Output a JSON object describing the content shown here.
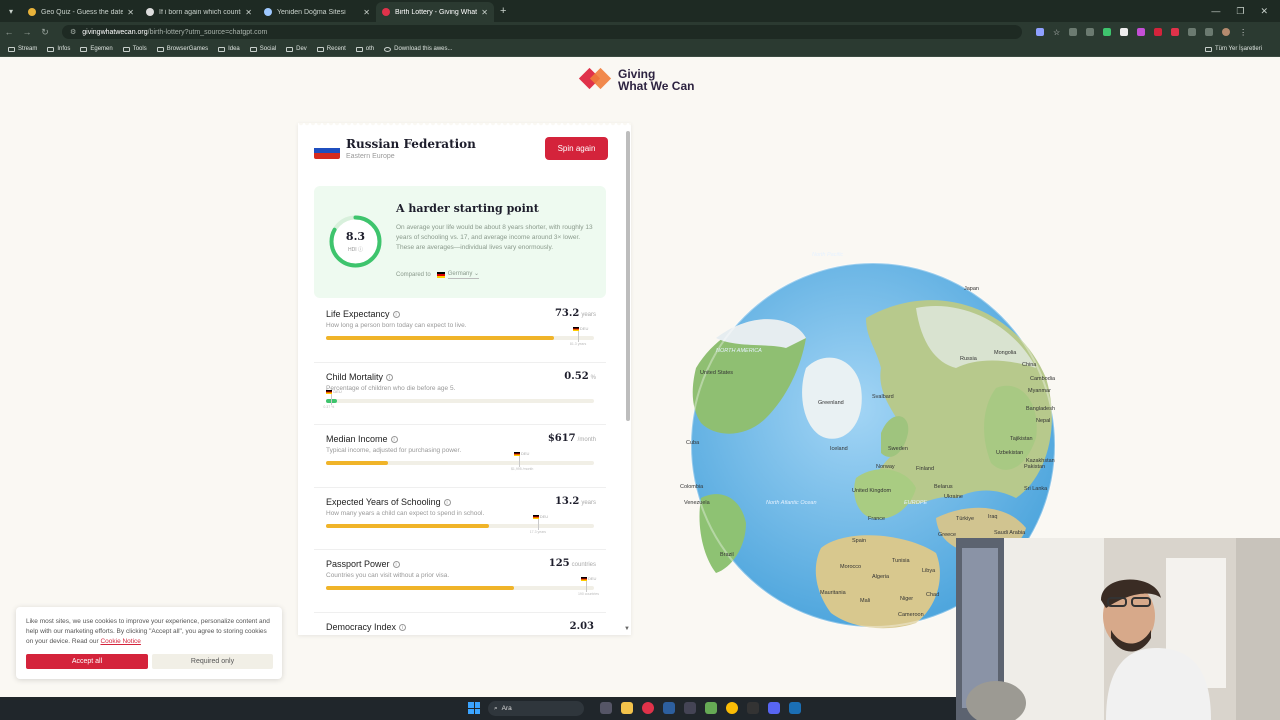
{
  "browser": {
    "tabs": [
      {
        "title": "Geo Quiz - Guess the date and"
      },
      {
        "title": "If i born again which country w"
      },
      {
        "title": "Yeniden Doğma Sitesi"
      },
      {
        "title": "Birth Lottery - Giving What We"
      }
    ],
    "url_domain": "givingwhatwecan.org",
    "url_path": "/birth-lottery?utm_source=chatgpt.com",
    "bookmarks": [
      "Stream",
      "Infos",
      "Egemen",
      "Tools",
      "BrowserGames",
      "Idea",
      "Social",
      "Dev",
      "Recent",
      "oth",
      "Download this awes..."
    ],
    "bookmarks_all": "Tüm Yer İşaretleri"
  },
  "logo": {
    "line1": "Giving",
    "line2": "What We Can"
  },
  "card": {
    "country": "Russian Federation",
    "region": "Eastern Europe",
    "spin_label": "Spin again",
    "summary": {
      "hdi_value": "8.3",
      "hdi_label": "HDI",
      "hdi_fraction": 0.83,
      "title": "A harder starting point",
      "text": "On average your life would be about 8 years shorter, with roughly 13 years of schooling vs. 17, and average income around 3× lower. These are averages—individual lives vary enormously.",
      "compared_label": "Compared to",
      "compared_country": "Germany"
    },
    "metrics": [
      {
        "name": "Life Expectancy",
        "desc": "How long a person born today can expect to live.",
        "value": "73.2",
        "unit": "years",
        "fill_pct": 85,
        "ref_pct": 94,
        "ref_flag": "DEU",
        "ref_value": "81.3 years",
        "color": "#f0b429"
      },
      {
        "name": "Child Mortality",
        "desc": "Percentage of children who die before age 5.",
        "value": "0.52",
        "unit": "%",
        "fill_pct": 4,
        "ref_pct": 2,
        "ref_flag": "DEU",
        "ref_value": "0.37 %",
        "color": "#3ec46d"
      },
      {
        "name": "Median Income",
        "desc": "Typical income, adjusted for purchasing power.",
        "value": "$617",
        "unit": "/month",
        "fill_pct": 23,
        "ref_pct": 72,
        "ref_flag": "DEU",
        "ref_value": "$1,995 /month",
        "color": "#f0b429"
      },
      {
        "name": "Expected Years of Schooling",
        "desc": "How many years a child can expect to spend in school.",
        "value": "13.2",
        "unit": "years",
        "fill_pct": 61,
        "ref_pct": 79,
        "ref_flag": "DEU",
        "ref_value": "17.3 years",
        "color": "#f0b429"
      },
      {
        "name": "Passport Power",
        "desc": "Countries you can visit without a prior visa.",
        "value": "125",
        "unit": "countries",
        "fill_pct": 70,
        "ref_pct": 97,
        "ref_flag": "DEU",
        "ref_value": "190 countries",
        "color": "#f0b429"
      },
      {
        "name": "Democracy Index",
        "desc": "",
        "value": "2.03",
        "unit": "",
        "fill_pct": 0,
        "ref_pct": 0,
        "ref_flag": "",
        "ref_value": "",
        "color": "#f0b429"
      }
    ]
  },
  "cookie": {
    "text": "Like most sites, we use cookies to improve your experience, personalize content and help with our marketing efforts. By clicking \"Accept all\", you agree to storing cookies on your device. Read our",
    "link": "Cookie Notice",
    "accept_label": "Accept all",
    "required_label": "Required only"
  },
  "globe": {
    "labels": [
      "North Pacific",
      "Japan",
      "Mongolia",
      "China",
      "Russia",
      "Cambodia",
      "Myanmar",
      "Bangladesh",
      "Nepal",
      "Tajikistan",
      "Uzbekistan",
      "Pakistan",
      "Sri Lanka",
      "Kazakhstan",
      "United States",
      "NORTH AMERICA",
      "Svalbard",
      "Greenland",
      "Cuba",
      "Iceland",
      "Sweden",
      "Norway",
      "Finland",
      "United Kingdom",
      "Belarus",
      "Ukraine",
      "France",
      "EUROPE",
      "Spain",
      "Türkiye",
      "Iraq",
      "Colombia",
      "Venezuela",
      "North Atlantic Ocean",
      "Brazil",
      "Morocco",
      "Algeria",
      "Tunisia",
      "Libya",
      "Greece",
      "Mauritania",
      "Mali",
      "Niger",
      "Chad",
      "Cameroon",
      "Saudi Arabia"
    ]
  },
  "taskbar": {
    "search": "Ara"
  },
  "colors": {
    "accent": "#d4233b",
    "bar_fill": "#f0b429",
    "good": "#3ec46d",
    "ocean": "#7cc0ea"
  }
}
